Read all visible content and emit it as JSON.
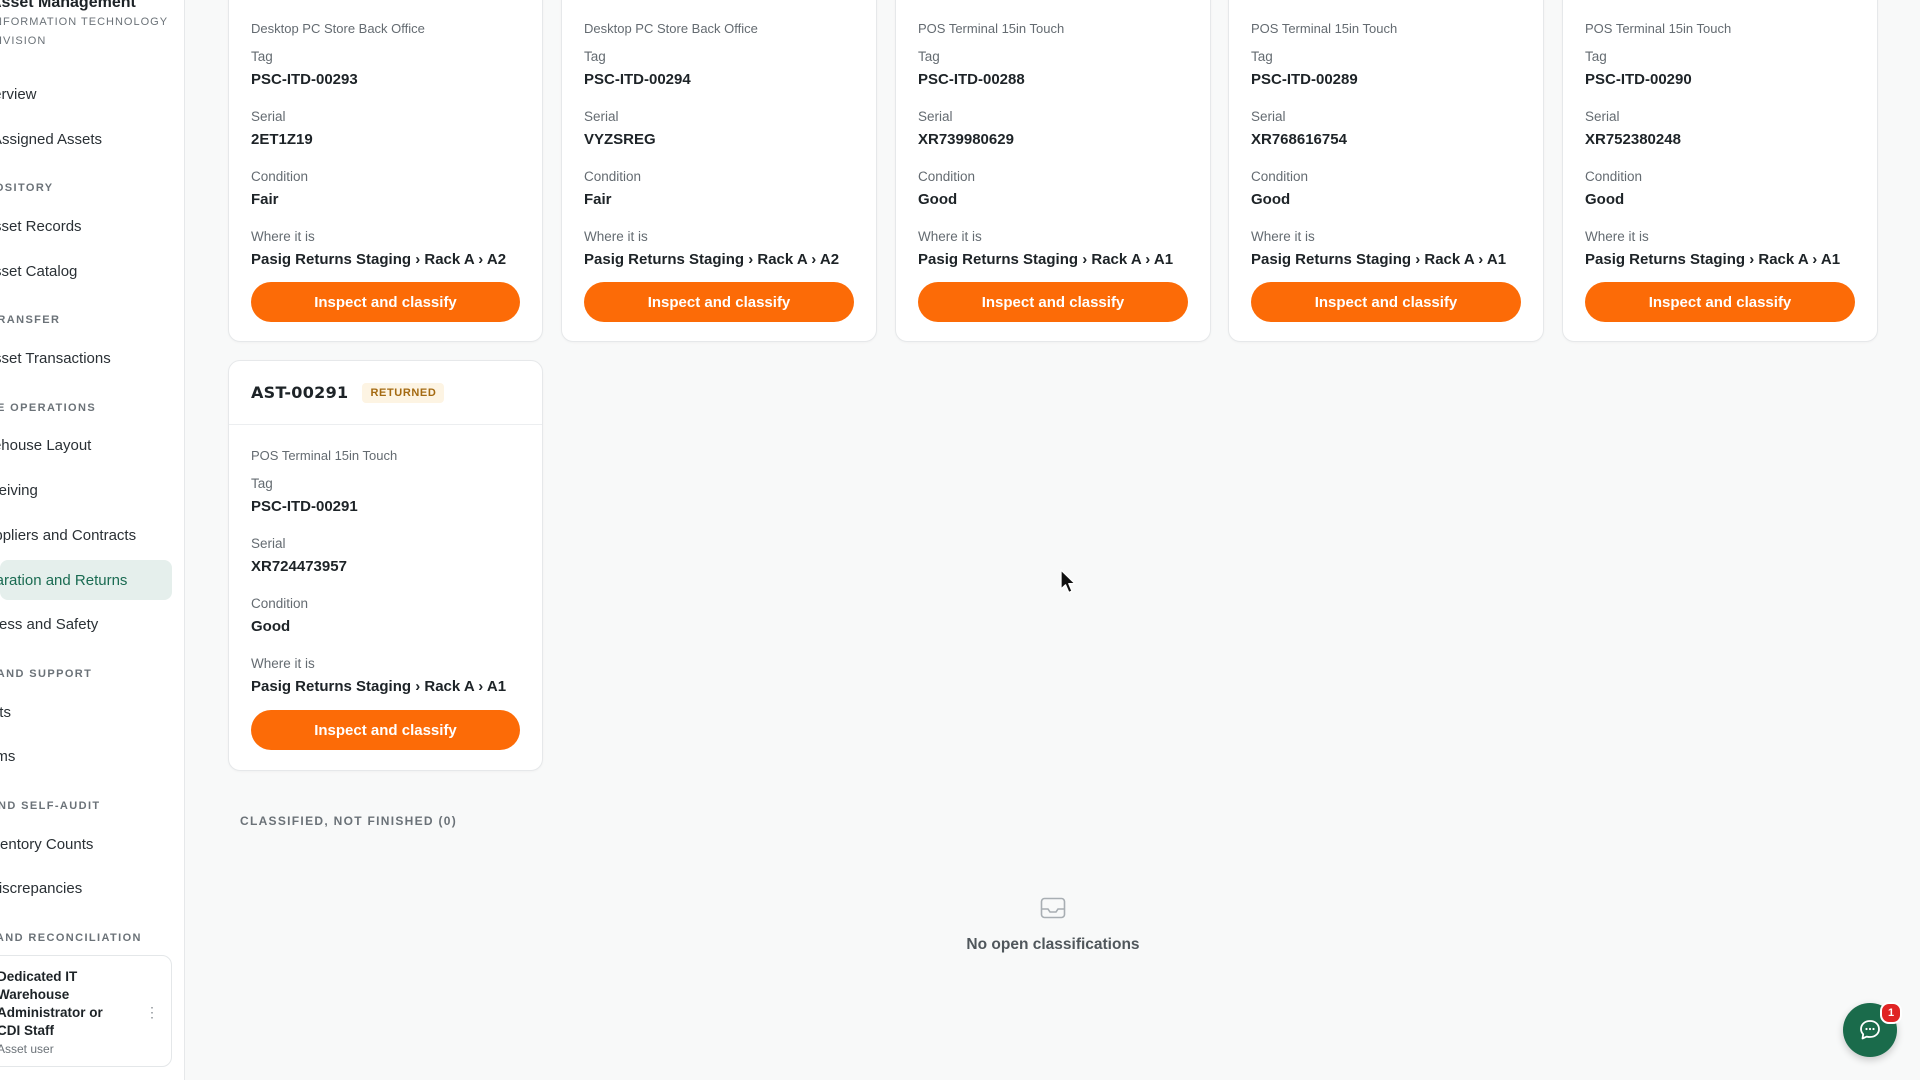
{
  "sidebar": {
    "brand_title": "Asset Management",
    "brand_sub_1": "INFORMATION TECHNOLOGY",
    "brand_sub_2": "DIVISION",
    "items": [
      {
        "label": "Overview"
      },
      {
        "label": "Assigned Assets"
      },
      {
        "label": "Asset Records"
      },
      {
        "label": "Asset Catalog"
      },
      {
        "label": "Asset Transactions"
      },
      {
        "label": "Warehouse Layout"
      },
      {
        "label": "Receiving"
      },
      {
        "label": "Suppliers and Contracts"
      },
      {
        "label": "Preparation and Returns"
      },
      {
        "label": "Access and Safety"
      },
      {
        "label": "Tickets"
      },
      {
        "label": "Problems"
      },
      {
        "label": "Inventory Counts"
      },
      {
        "label": "Discrepancies"
      }
    ],
    "sections": [
      {
        "label": "REPOSITORY"
      },
      {
        "label": "MOVEMENT AND TRANSFER"
      },
      {
        "label": "WAREHOUSE OPERATIONS"
      },
      {
        "label": "HELP AND SUPPORT"
      },
      {
        "label": "AUDIT AND SELF-AUDIT"
      },
      {
        "label": "COUNTING AND RECONCILIATION"
      }
    ],
    "user": {
      "name": "Dedicated IT Warehouse Administrator or CDI Staff",
      "role": "Asset user"
    }
  },
  "labels": {
    "tag": "Tag",
    "serial": "Serial",
    "condition": "Condition",
    "where": "Where it is",
    "action": "Inspect and classify"
  },
  "cards": [
    {
      "model": "Desktop PC Store Back Office",
      "tag": "PSC-ITD-00293",
      "serial": "2ET1Z19",
      "condition": "Fair",
      "location": "Pasig Returns Staging › Rack A › A2"
    },
    {
      "model": "Desktop PC Store Back Office",
      "tag": "PSC-ITD-00294",
      "serial": "VYZSREG",
      "condition": "Fair",
      "location": "Pasig Returns Staging › Rack A › A2"
    },
    {
      "model": "POS Terminal 15in Touch",
      "tag": "PSC-ITD-00288",
      "serial": "XR739980629",
      "condition": "Good",
      "location": "Pasig Returns Staging › Rack A › A1"
    },
    {
      "model": "POS Terminal 15in Touch",
      "tag": "PSC-ITD-00289",
      "serial": "XR768616754",
      "condition": "Good",
      "location": "Pasig Returns Staging › Rack A › A1"
    },
    {
      "model": "POS Terminal 15in Touch",
      "tag": "PSC-ITD-00290",
      "serial": "XR752380248",
      "condition": "Good",
      "location": "Pasig Returns Staging › Rack A › A1"
    },
    {
      "id": "AST-00291",
      "status": "RETURNED",
      "model": "POS Terminal 15in Touch",
      "tag": "PSC-ITD-00291",
      "serial": "XR724473957",
      "condition": "Good",
      "location": "Pasig Returns Staging › Rack A › A1"
    }
  ],
  "classified_section": {
    "title": "CLASSIFIED, NOT FINISHED (0)",
    "empty_text": "No open classifications"
  },
  "chat": {
    "badge_count": "1"
  },
  "colors": {
    "accent": "#fc6b07",
    "brand_green": "#1a6b4b",
    "active_bg": "#e5efec",
    "badge_bg": "#fdf4e3",
    "badge_text": "#a46a12"
  }
}
